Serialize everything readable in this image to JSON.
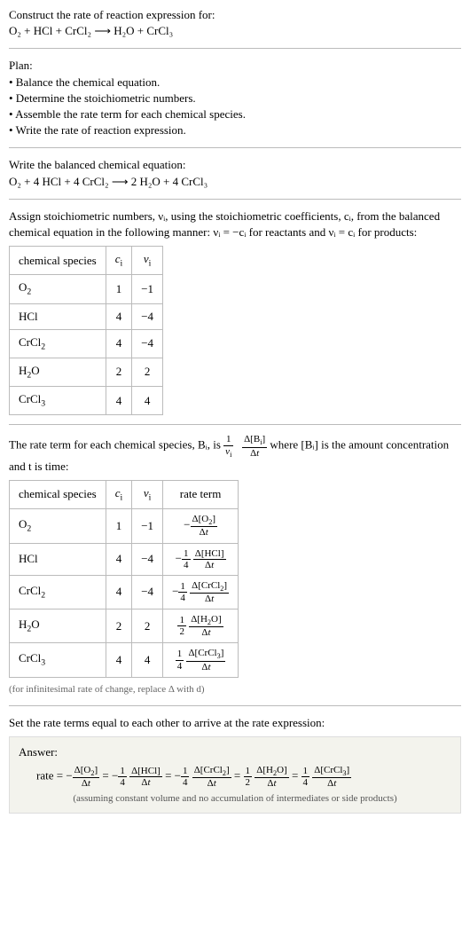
{
  "header": {
    "prompt": "Construct the rate of reaction expression for:",
    "equation_unbalanced": "O₂ + HCl + CrCl₂  ⟶  H₂O + CrCl₃"
  },
  "plan": {
    "heading": "Plan:",
    "items": [
      "Balance the chemical equation.",
      "Determine the stoichiometric numbers.",
      "Assemble the rate term for each chemical species.",
      "Write the rate of reaction expression."
    ]
  },
  "balanced": {
    "heading": "Write the balanced chemical equation:",
    "equation": "O₂ + 4 HCl + 4 CrCl₂  ⟶  2 H₂O + 4 CrCl₃"
  },
  "stoich_text": "Assign stoichiometric numbers, νᵢ, using the stoichiometric coefficients, cᵢ, from the balanced chemical equation in the following manner: νᵢ = −cᵢ for reactants and νᵢ = cᵢ for products:",
  "stoich_table": {
    "headers": [
      "chemical species",
      "cᵢ",
      "νᵢ"
    ],
    "rows": [
      [
        "O₂",
        "1",
        "−1"
      ],
      [
        "HCl",
        "4",
        "−4"
      ],
      [
        "CrCl₂",
        "4",
        "−4"
      ],
      [
        "H₂O",
        "2",
        "2"
      ],
      [
        "CrCl₃",
        "4",
        "4"
      ]
    ]
  },
  "rate_term_intro_a": "The rate term for each chemical species, Bᵢ, is ",
  "rate_term_intro_b": " where [Bᵢ] is the amount concentration and t is time:",
  "rate_table": {
    "headers": [
      "chemical species",
      "cᵢ",
      "νᵢ",
      "rate term"
    ],
    "rows": [
      {
        "sp": "O₂",
        "c": "1",
        "v": "−1",
        "neg": "−",
        "coef": "",
        "num": "Δ[O₂]",
        "den": "Δt"
      },
      {
        "sp": "HCl",
        "c": "4",
        "v": "−4",
        "neg": "−",
        "coef": "1/4",
        "num": "Δ[HCl]",
        "den": "Δt"
      },
      {
        "sp": "CrCl₂",
        "c": "4",
        "v": "−4",
        "neg": "−",
        "coef": "1/4",
        "num": "Δ[CrCl₂]",
        "den": "Δt"
      },
      {
        "sp": "H₂O",
        "c": "2",
        "v": "2",
        "neg": "",
        "coef": "1/2",
        "num": "Δ[H₂O]",
        "den": "Δt"
      },
      {
        "sp": "CrCl₃",
        "c": "4",
        "v": "4",
        "neg": "",
        "coef": "1/4",
        "num": "Δ[CrCl₃]",
        "den": "Δt"
      }
    ]
  },
  "inf_note": "(for infinitesimal rate of change, replace Δ with d)",
  "final_heading": "Set the rate terms equal to each other to arrive at the rate expression:",
  "answer": {
    "label": "Answer:",
    "prefix": "rate = ",
    "terms": [
      {
        "neg": "−",
        "coef": "",
        "num": "Δ[O₂]",
        "den": "Δt"
      },
      {
        "neg": "−",
        "coef": "1/4",
        "num": "Δ[HCl]",
        "den": "Δt"
      },
      {
        "neg": "−",
        "coef": "1/4",
        "num": "Δ[CrCl₂]",
        "den": "Δt"
      },
      {
        "neg": "",
        "coef": "1/2",
        "num": "Δ[H₂O]",
        "den": "Δt"
      },
      {
        "neg": "",
        "coef": "1/4",
        "num": "Δ[CrCl₃]",
        "den": "Δt"
      }
    ],
    "note": "(assuming constant volume and no accumulation of intermediates or side products)"
  },
  "chart_data": {
    "type": "table",
    "tables": [
      {
        "title": "Stoichiometric numbers",
        "columns": [
          "chemical species",
          "c_i",
          "ν_i"
        ],
        "rows": [
          [
            "O2",
            1,
            -1
          ],
          [
            "HCl",
            4,
            -4
          ],
          [
            "CrCl2",
            4,
            -4
          ],
          [
            "H2O",
            2,
            2
          ],
          [
            "CrCl3",
            4,
            4
          ]
        ]
      },
      {
        "title": "Rate terms",
        "columns": [
          "chemical species",
          "c_i",
          "ν_i",
          "rate term"
        ],
        "rows": [
          [
            "O2",
            1,
            -1,
            "-Δ[O2]/Δt"
          ],
          [
            "HCl",
            4,
            -4,
            "-(1/4)Δ[HCl]/Δt"
          ],
          [
            "CrCl2",
            4,
            -4,
            "-(1/4)Δ[CrCl2]/Δt"
          ],
          [
            "H2O",
            2,
            2,
            "(1/2)Δ[H2O]/Δt"
          ],
          [
            "CrCl3",
            4,
            4,
            "(1/4)Δ[CrCl3]/Δt"
          ]
        ]
      }
    ],
    "rate_expression": "rate = -Δ[O2]/Δt = -(1/4)Δ[HCl]/Δt = -(1/4)Δ[CrCl2]/Δt = (1/2)Δ[H2O]/Δt = (1/4)Δ[CrCl3]/Δt"
  }
}
